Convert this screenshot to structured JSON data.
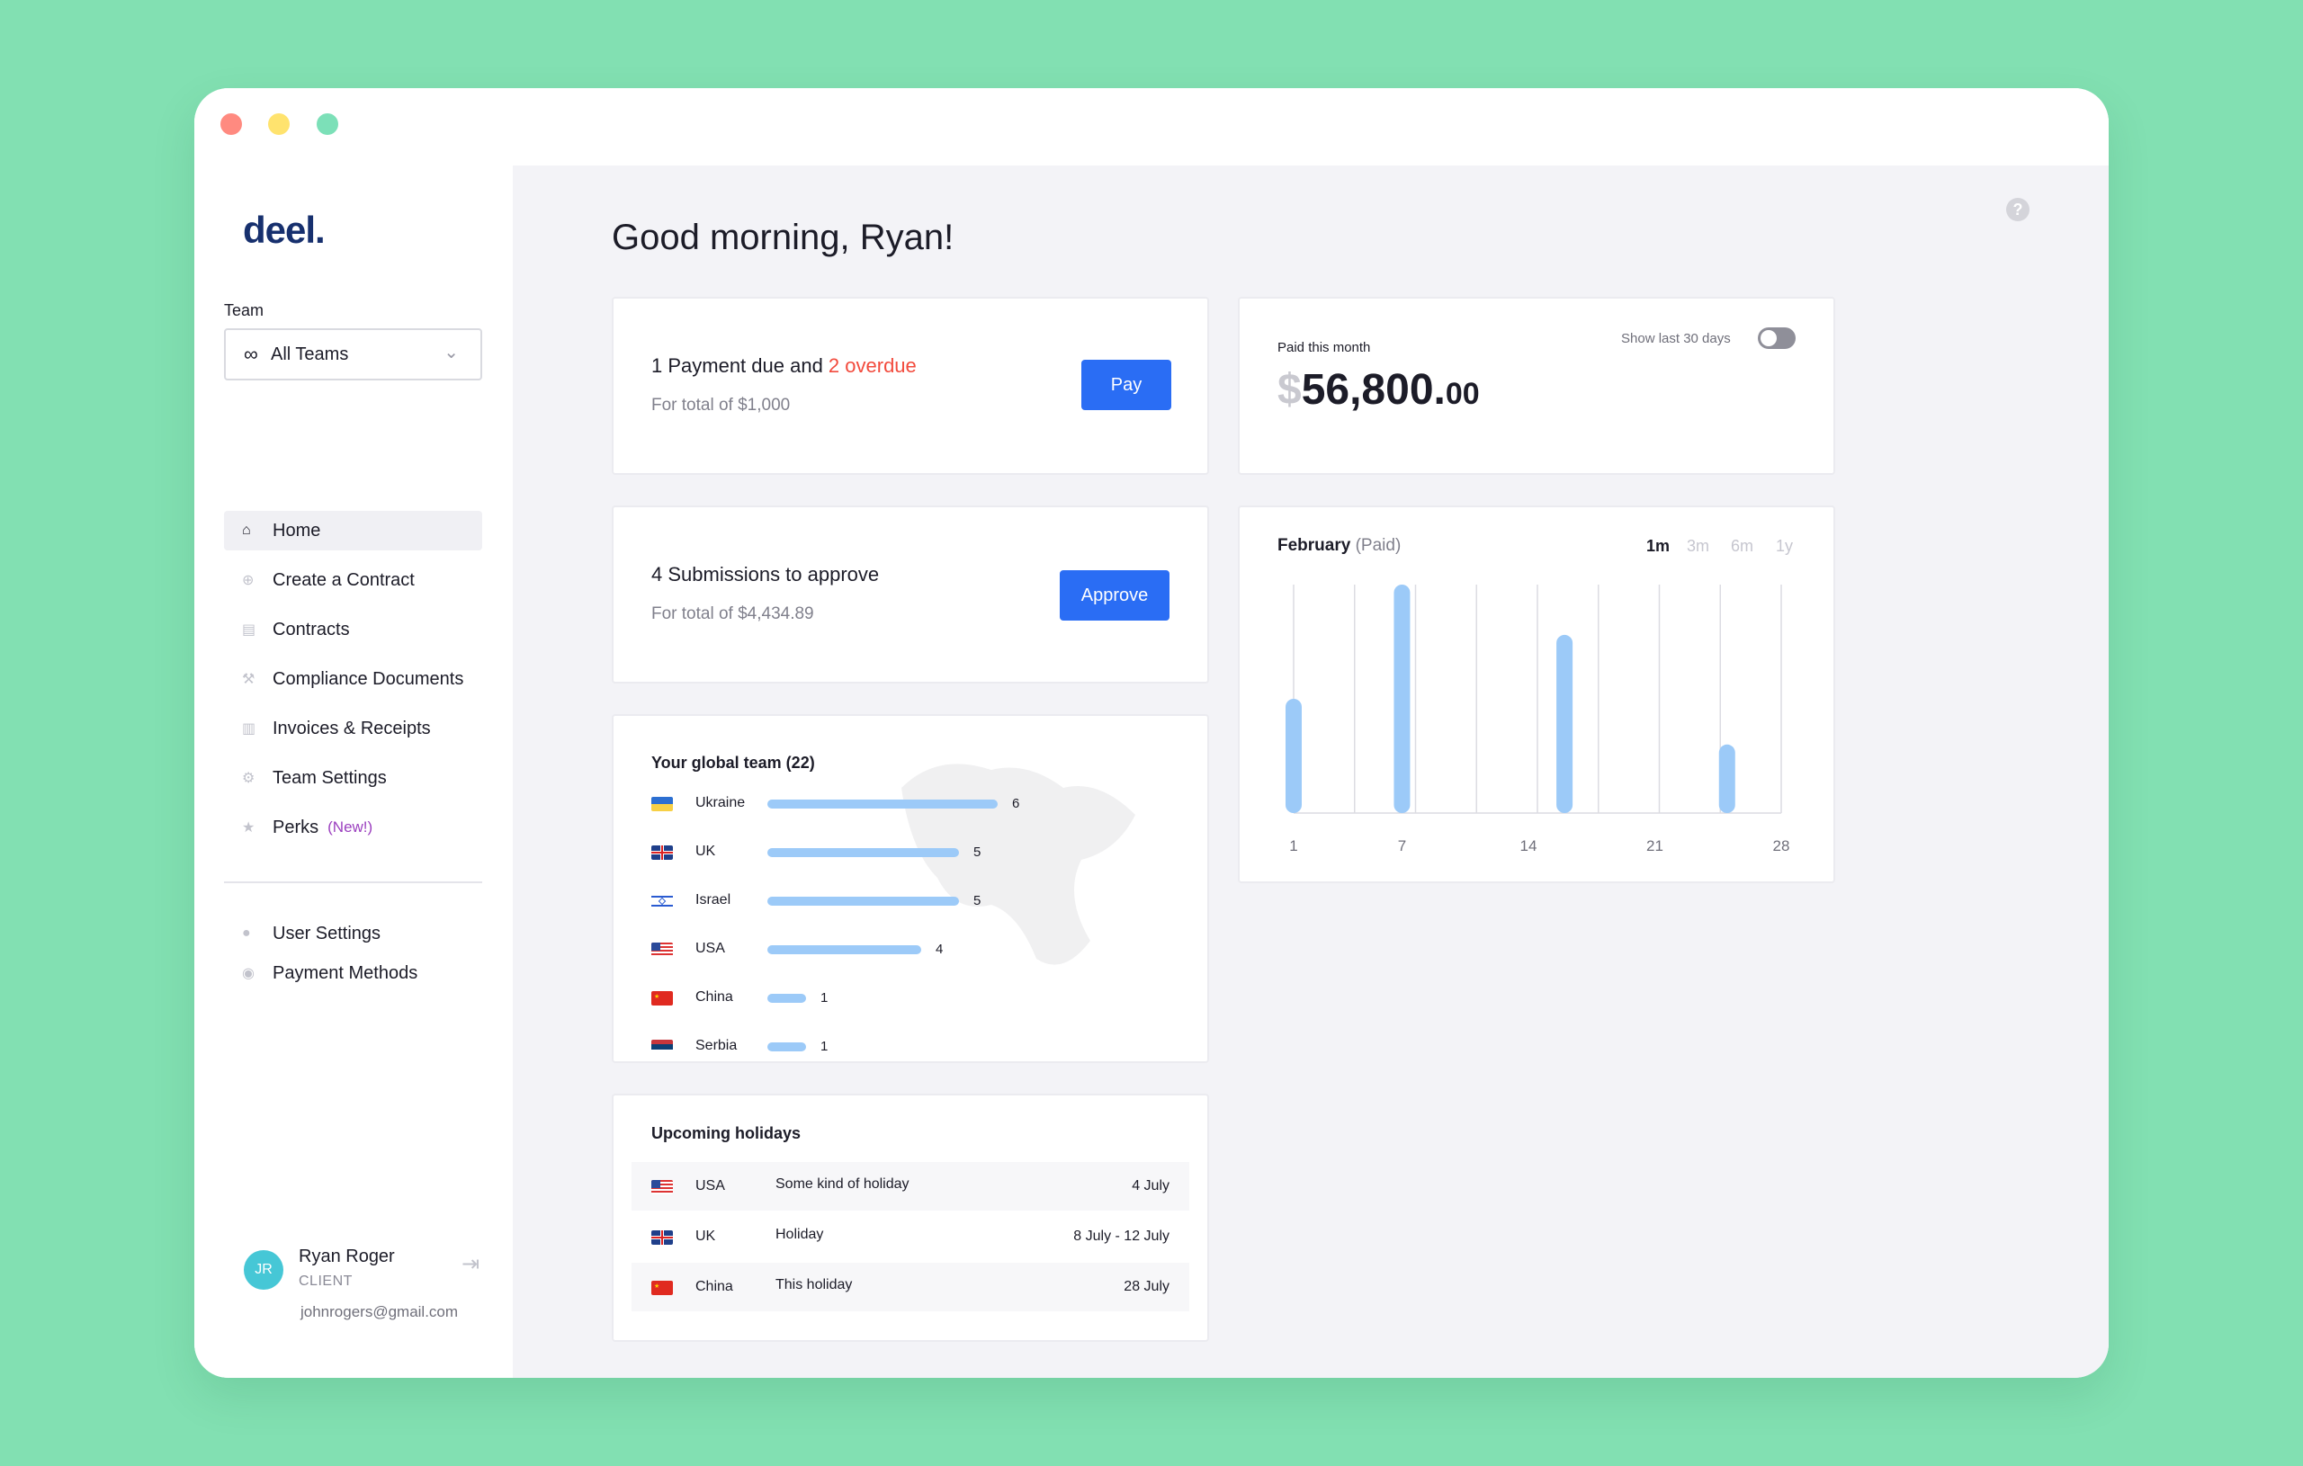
{
  "sidebar": {
    "logo": "deel.",
    "team_label": "Team",
    "team_value": "All Teams",
    "nav": [
      {
        "label": "Home",
        "icon": "home-icon"
      },
      {
        "label": "Create a Contract",
        "icon": "plus-circle-icon"
      },
      {
        "label": "Contracts",
        "icon": "document-icon"
      },
      {
        "label": "Compliance Documents",
        "icon": "hammer-icon"
      },
      {
        "label": "Invoices & Receipts",
        "icon": "receipt-icon"
      },
      {
        "label": "Team Settings",
        "icon": "gear-icon"
      },
      {
        "label": "Perks",
        "icon": "star-icon",
        "badge": "(New!)"
      }
    ],
    "nav2": [
      {
        "label": "User Settings",
        "icon": "user-icon"
      },
      {
        "label": "Payment Methods",
        "icon": "card-icon"
      }
    ],
    "user": {
      "initials": "JR",
      "name": "Ryan Roger",
      "role": "CLIENT",
      "email": "johnrogers@gmail.com"
    }
  },
  "main": {
    "greeting": "Good morning, Ryan!",
    "payment_card": {
      "title_a": "1 Payment due and ",
      "title_b": "2 overdue",
      "subtitle": "For total of $1,000",
      "button": "Pay"
    },
    "submissions_card": {
      "title": "4 Submissions to approve",
      "subtitle": "For total of $4,434.89",
      "button": "Approve"
    },
    "paid_card": {
      "label": "Paid this month",
      "toggle_label": "Show last 30 days",
      "toggle_on": false,
      "currency": "$",
      "amount": "56,800.",
      "decimals": "00"
    },
    "team_card": {
      "title": "Your global team (22)",
      "rows": [
        {
          "country": "Ukraine",
          "count": 6
        },
        {
          "country": "UK",
          "count": 5
        },
        {
          "country": "Israel",
          "count": 5
        },
        {
          "country": "USA",
          "count": 4
        },
        {
          "country": "China",
          "count": 1
        },
        {
          "country": "Serbia",
          "count": 1
        }
      ]
    },
    "holidays_card": {
      "title": "Upcoming holidays",
      "rows": [
        {
          "country": "USA",
          "name": "Some kind of holiday",
          "date": "4 July"
        },
        {
          "country": "UK",
          "name": "Holiday",
          "date": "8 July - 12 July"
        },
        {
          "country": "China",
          "name": "This holiday",
          "date": "28 July"
        }
      ]
    }
  },
  "chart_data": {
    "type": "bar",
    "title": "February",
    "title_suffix": "(Paid)",
    "ranges": [
      "1m",
      "3m",
      "6m",
      "1y"
    ],
    "selected_range": "1m",
    "x_ticks": [
      "1",
      "7",
      "14",
      "21",
      "28"
    ],
    "x": [
      1,
      7,
      16,
      25
    ],
    "values": [
      0.5,
      1.0,
      0.78,
      0.3
    ],
    "xlim": [
      1,
      28
    ],
    "ylim": [
      0,
      1
    ],
    "bar_color": "#9ccaf8",
    "grid": true
  },
  "colors": {
    "accent": "#2a6df4",
    "overdue": "#f24a3c",
    "perks_badge": "#9b3fbf",
    "background": "#82e0b2"
  }
}
